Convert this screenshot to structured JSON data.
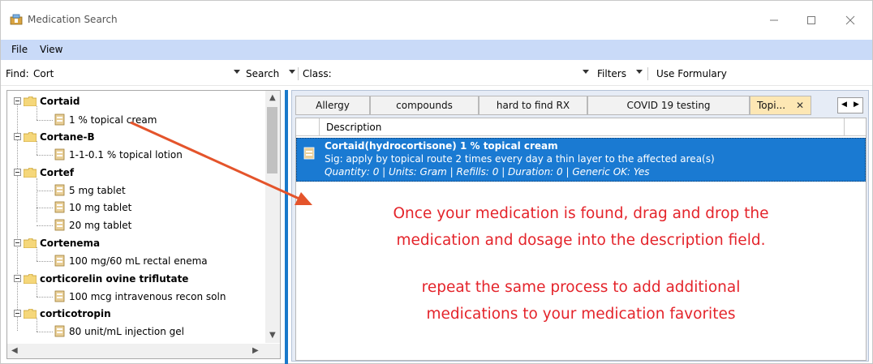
{
  "window": {
    "title": "Medication Search",
    "controls": [
      "minimize",
      "maximize",
      "close"
    ]
  },
  "menu": [
    "File",
    "View"
  ],
  "find_bar": {
    "find_label": "Find:",
    "find_value": "Cort",
    "search_label": "Search",
    "class_label": "Class:",
    "filters_label": "Filters",
    "formulary_label": "Use Formulary"
  },
  "tree": [
    {
      "name": "Cortaid",
      "items": [
        "1 % topical cream"
      ]
    },
    {
      "name": "Cortane-B",
      "items": [
        "1-1-0.1 % topical lotion"
      ]
    },
    {
      "name": "Cortef",
      "items": [
        "5 mg tablet",
        "10 mg tablet",
        "20 mg tablet"
      ]
    },
    {
      "name": "Cortenema",
      "items": [
        "100 mg/60 mL rectal enema"
      ]
    },
    {
      "name": "corticorelin ovine triflutate",
      "items": [
        "100 mcg intravenous recon soln"
      ]
    },
    {
      "name": "corticotropin",
      "items": [
        "80 unit/mL injection gel"
      ]
    }
  ],
  "tabs": [
    {
      "label": "Allergy",
      "active": false
    },
    {
      "label": "compounds",
      "active": false
    },
    {
      "label": "hard to find RX",
      "active": false
    },
    {
      "label": "COVID 19 testing",
      "active": false
    },
    {
      "label": "Topi...",
      "active": true
    }
  ],
  "grid": {
    "header": "Description",
    "rows": [
      {
        "title": "Cortaid(hydrocortisone) 1 % topical cream",
        "sig": "Sig: apply by topical route 2 times every day a thin layer to the affected area(s)",
        "details": "Quantity: 0 | Units: Gram | Refills: 0 | Duration: 0 | Generic OK: Yes"
      }
    ]
  },
  "annotation": {
    "line1": "Once your medication is found, drag and drop the",
    "line2": "medication and dosage into the description field.",
    "line3": "repeat the same process to add additional",
    "line4": "medications to your medication favorites",
    "color": "#e4242b"
  },
  "colors": {
    "menu_bar": "#c9daf8",
    "selection": "#1a7ad2",
    "active_tab": "#fde7b4",
    "splitter": "#1979ca"
  }
}
